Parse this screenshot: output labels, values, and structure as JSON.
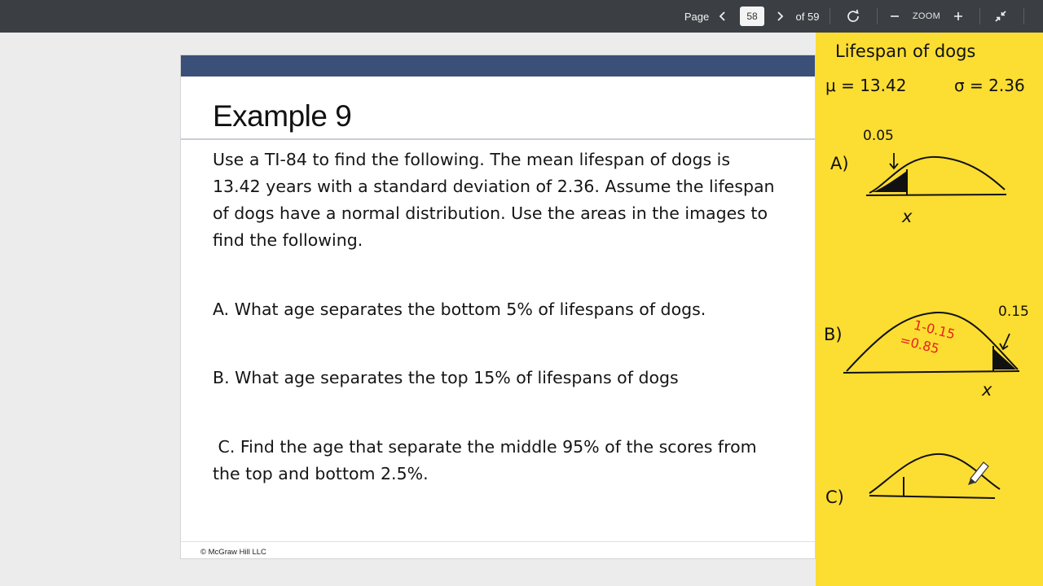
{
  "viewer": {
    "page_label": "Page",
    "current_page": "58",
    "page_total": "of 59",
    "zoom_label": "ZOOM"
  },
  "slide": {
    "title": "Example 9",
    "intro_lines": [
      "Use a TI-84 to find the following. The mean lifespan of dogs is",
      "13.42 years with a standard deviation of 2.36.  Assume the lifespan",
      "of dogs have a normal distribution.  Use the areas in the images to",
      "find the following."
    ],
    "question_a": "A. What age separates the bottom 5% of lifespans of dogs.",
    "question_b": "B. What age separates the top 15% of lifespans of dogs",
    "question_c_lines": [
      " C. Find the age that separate the middle 95% of the scores from",
      "the top and bottom 2.5%."
    ],
    "footer": "© McGraw Hill LLC"
  },
  "notes": {
    "heading": "Lifespan of dogs",
    "mu": "μ = 13.42",
    "sigma": "σ = 2.36",
    "a_label": "A)",
    "a_area": "0.05",
    "a_var": "x",
    "b_label": "B)",
    "b_area": "0.15",
    "b_red_1": "1-0.15",
    "b_red_2": "=0.85",
    "b_var": "x",
    "c_label": "C)",
    "ink_color": "#111111",
    "red_ink": "#e8201c",
    "paper_color": "#fcdd32"
  }
}
